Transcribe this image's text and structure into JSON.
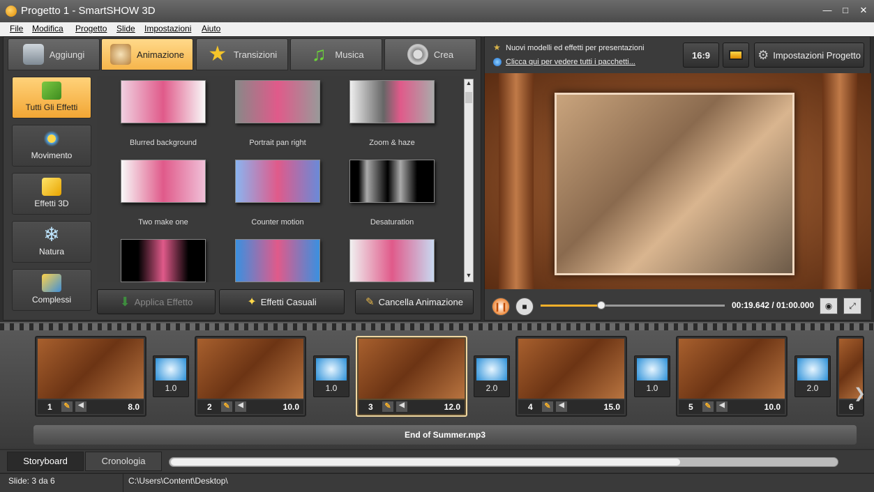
{
  "window": {
    "title": "Progetto 1 - SmartSHOW 3D"
  },
  "menu": [
    "File",
    "Modifica",
    "Progetto",
    "Slide",
    "Impostazioni",
    "Aiuto"
  ],
  "main_tabs": [
    {
      "label": "Aggiungi",
      "icon": "camera-icon"
    },
    {
      "label": "Animazione",
      "icon": "palette-icon",
      "active": true
    },
    {
      "label": "Transizioni",
      "icon": "star-icon"
    },
    {
      "label": "Musica",
      "icon": "music-note-icon"
    },
    {
      "label": "Crea",
      "icon": "film-reel-icon"
    }
  ],
  "categories": [
    {
      "label": "Tutti Gli Effetti",
      "icon": "puzzle-icon",
      "active": true
    },
    {
      "label": "Movimento",
      "icon": "move-arrows-icon"
    },
    {
      "label": "Effetti 3D",
      "icon": "cube-icon"
    },
    {
      "label": "Natura",
      "icon": "snowflake-icon"
    },
    {
      "label": "Complessi",
      "icon": "layers-icon"
    }
  ],
  "effects": [
    {
      "label": "Blurred background"
    },
    {
      "label": "Portrait pan right"
    },
    {
      "label": "Zoom & haze"
    },
    {
      "label": "Two make one"
    },
    {
      "label": "Counter motion"
    },
    {
      "label": "Desaturation"
    },
    {
      "label": ""
    },
    {
      "label": ""
    },
    {
      "label": ""
    }
  ],
  "actions": {
    "apply": "Applica Effetto",
    "random": "Effetti Casuali",
    "cancel": "Cancella Animazione"
  },
  "promo": {
    "line1": "Nuovi modelli ed effetti per presentazioni",
    "line2": "Clicca qui per vedere tutti i pacchetti..."
  },
  "top_right": {
    "ratio": "16:9",
    "settings": "Impostazioni Progetto"
  },
  "player": {
    "time": "00:19.642 / 01:00.000",
    "progress": 0.33
  },
  "slides": [
    {
      "num": "1",
      "duration": "8.0"
    },
    {
      "num": "2",
      "duration": "10.0"
    },
    {
      "num": "3",
      "duration": "12.0",
      "selected": true
    },
    {
      "num": "4",
      "duration": "15.0"
    },
    {
      "num": "5",
      "duration": "10.0"
    },
    {
      "num": "6",
      "duration": ""
    }
  ],
  "transitions": [
    "1.0",
    "1.0",
    "2.0",
    "1.0",
    "2.0"
  ],
  "music_track": "End of Summer.mp3",
  "bottom_tabs": [
    "Storyboard",
    "Cronologia"
  ],
  "status": {
    "slide": "Slide: 3 da 6",
    "path": "C:\\Users\\Content\\Desktop\\"
  }
}
